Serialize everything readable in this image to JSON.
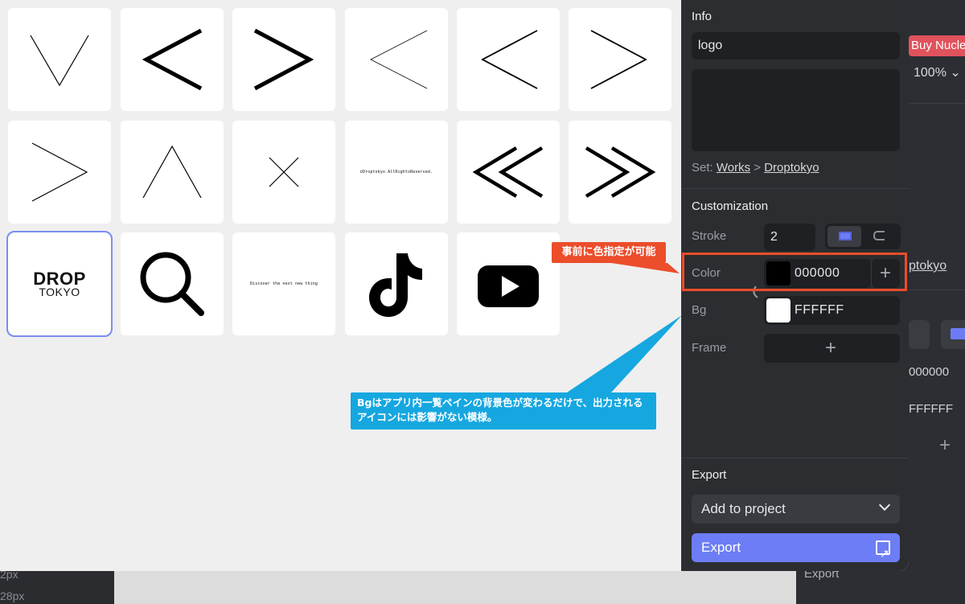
{
  "background": {
    "buy_label": "Buy Nucle",
    "zoom": "100%",
    "link_text": "ptokyo",
    "color_value": "000000",
    "bg_value": "FFFFFF",
    "export_label": "Export",
    "px_labels": [
      "2px",
      "28px"
    ]
  },
  "tiles": [
    {
      "name": "chevron-down-thin-icon"
    },
    {
      "name": "chevron-left-bold-icon"
    },
    {
      "name": "chevron-right-bold-icon"
    },
    {
      "name": "chevron-left-thin-icon"
    },
    {
      "name": "chevron-left-medium-icon"
    },
    {
      "name": "chevron-right-medium-icon"
    },
    {
      "name": "chevron-right-thin-icon"
    },
    {
      "name": "chevron-up-thin-icon"
    },
    {
      "name": "close-x-icon"
    },
    {
      "name": "copyright-text-tile",
      "text": "©Droptokyo AllRightsReserved."
    },
    {
      "name": "double-chevron-left-icon"
    },
    {
      "name": "double-chevron-right-icon"
    },
    {
      "name": "drop-tokyo-logo",
      "line1": "DROP",
      "line2": "TOKYO"
    },
    {
      "name": "search-icon"
    },
    {
      "name": "tagline-text-tile",
      "text": "Discover the next new thing"
    },
    {
      "name": "tiktok-icon"
    },
    {
      "name": "youtube-icon"
    }
  ],
  "panel": {
    "info": {
      "title": "Info",
      "name_value": "logo",
      "set_prefix": "Set:",
      "set_link1": "Works",
      "set_sep": ">",
      "set_link2": "Droptokyo"
    },
    "customization": {
      "title": "Customization",
      "stroke_label": "Stroke",
      "stroke_value": "2",
      "color_label": "Color",
      "color_value": "000000",
      "color_swatch": "#000000",
      "bg_label": "Bg",
      "bg_value": "FFFFFF",
      "bg_swatch": "#FFFFFF",
      "frame_label": "Frame"
    },
    "export": {
      "title": "Export",
      "add_to_project": "Add to project",
      "export_button": "Export"
    }
  },
  "annotations": {
    "red_note": "事前に色指定が可能",
    "blue_note": "Bgはアプリ内一覧ペインの背景色が変わるだけで、出力されるアイコンには影響がない模様。"
  },
  "colors": {
    "accent": "#6d7df5",
    "annotation_red": "#ec4d2b",
    "annotation_blue": "#16a7e0",
    "panel_bg": "#2c2d31"
  }
}
